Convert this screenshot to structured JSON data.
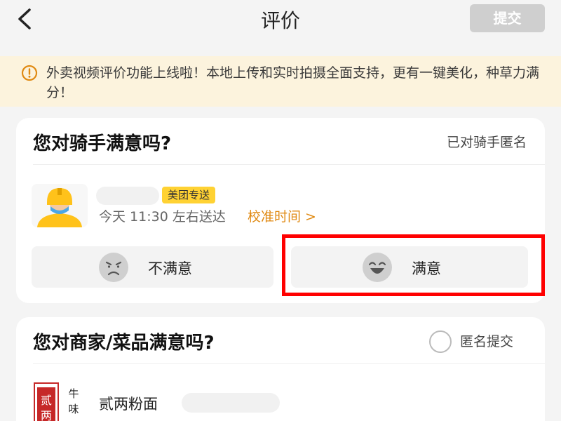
{
  "header": {
    "title": "评价",
    "submit_label": "提交"
  },
  "notice": {
    "text": "外卖视频评价功能上线啦！本地上传和实时拍摄全面支持，更有一键美化，种草力满分！"
  },
  "rider_section": {
    "title": "您对骑手满意吗?",
    "anonymous_label": "已对骑手匿名",
    "badge": "美团专送",
    "delivery_time": "今天 11:30 左右送达",
    "calibrate_label": "校准时间 >",
    "options": {
      "unsatisfied": "不满意",
      "satisfied": "满意"
    }
  },
  "merchant_section": {
    "title": "您对商家/菜品满意吗?",
    "anonymous_submit_label": "匿名提交",
    "shop_name": "贰两粉面",
    "logo_text": {
      "left": "贰两",
      "right": "牛味"
    }
  },
  "colors": {
    "accent": "#e08a13",
    "badge_bg": "#ffd233",
    "highlight": "#ff0000",
    "submit_disabled": "#cfcfcf"
  }
}
